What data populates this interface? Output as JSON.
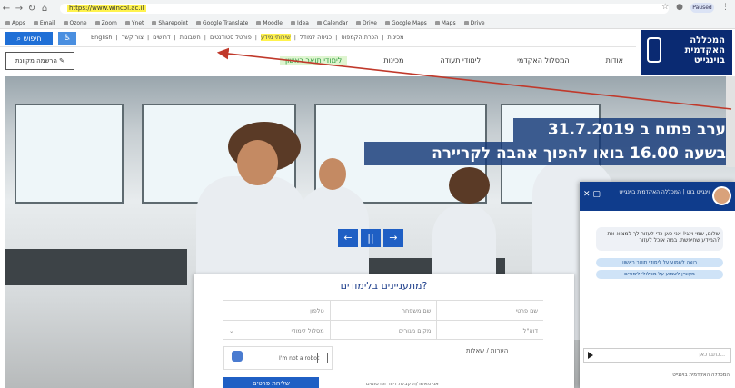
{
  "browser": {
    "url": "https://www.wincol.ac.il",
    "bookmarks": [
      "Apps",
      "Email",
      "Ozone",
      "Zoom",
      "Ynet",
      "Sharepoint",
      "Google Translate",
      "Moodle",
      "Idea",
      "Calendar",
      "Drive",
      "Google Maps",
      "Maps",
      "Drive"
    ],
    "profile": "Paused"
  },
  "topbar": {
    "search_label": "חיפוש",
    "links": [
      "English",
      "צור קשר",
      "דרושים",
      "חשבונות",
      "פורטל סטודנטים",
      "שירותי מידע",
      "כניסה למודל",
      "הכרת הקמפוס",
      "מכינות"
    ],
    "highlight": "שירותי מידע"
  },
  "logo": {
    "line1": "המכללה",
    "line2": "האקדמית",
    "line3": "בוינגייט"
  },
  "navbar": {
    "apply_label": "הרשמה מקוונת",
    "items": [
      "אודות",
      "המסלול האקדמי",
      "לימודי תעודה",
      "מכינות",
      "לימודי תואר ראשון"
    ]
  },
  "hero": {
    "headline1": "ערב פתוח ב 31.7.2019",
    "headline2": "בשעה 16.00 בואו להפוך אהבה לקריירה"
  },
  "slider": {
    "prev": "←",
    "pause": "||",
    "next": "→"
  },
  "form": {
    "title": "מתעניינים בלימודים?",
    "row1": [
      "שם פרטי",
      "שם משפחה",
      "טלפון"
    ],
    "row2": [
      "דוא\"ל",
      "מקום מגורים",
      "מסלול לימודי"
    ],
    "captcha_label": "I'm not a robot",
    "comment_label": "הערות / שאלות",
    "submit_label": "שליחת פרטים",
    "consent": "אני מאשר/ת קבלת דיוור ופרסומים"
  },
  "chat": {
    "header": "וינגייט בוט | המכללה האקדמית בוינגייט",
    "greeting": "שלום, שמי וינגי! אני כאן כדי לעזור לך למצוא את המידע שחיפשת. במה אוכל לעזור?",
    "options": [
      "רוצה לשמוע על לימודי תואר ראשון",
      "מעוניין לשמוע על מסלולי לימודים"
    ],
    "input_placeholder": "כתבו כאן...",
    "footer": "המכללה האקדמית בוינגייט"
  }
}
